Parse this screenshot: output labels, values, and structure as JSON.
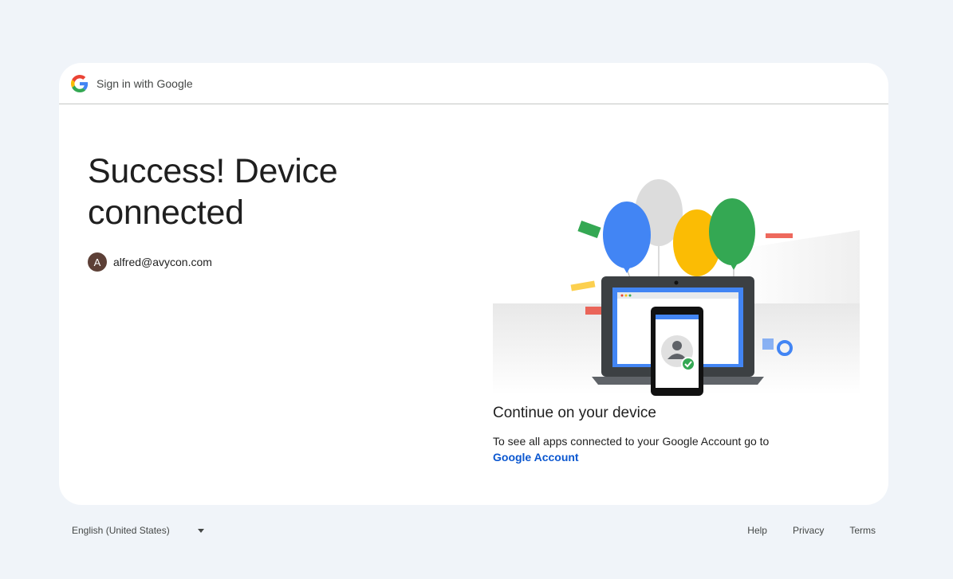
{
  "header": {
    "title": "Sign in with Google",
    "logo_icon": "google-g-icon"
  },
  "main": {
    "headline": "Success! Device connected",
    "account": {
      "avatar_letter": "A",
      "email": "alfred@avycon.com",
      "avatar_color": "#5d4037"
    }
  },
  "panel": {
    "subtitle": "Continue on your device",
    "description": "To see all apps connected to your Google Account go to",
    "link_label": "Google Account",
    "link_color": "#0b57d0"
  },
  "footer": {
    "language": "English (United States)",
    "links": {
      "help": "Help",
      "privacy": "Privacy",
      "terms": "Terms"
    }
  },
  "colors": {
    "background": "#f0f4f9",
    "card": "#ffffff",
    "google_blue": "#4285f4",
    "google_red": "#ea4335",
    "google_yellow": "#fbbc04",
    "google_green": "#34a853"
  }
}
